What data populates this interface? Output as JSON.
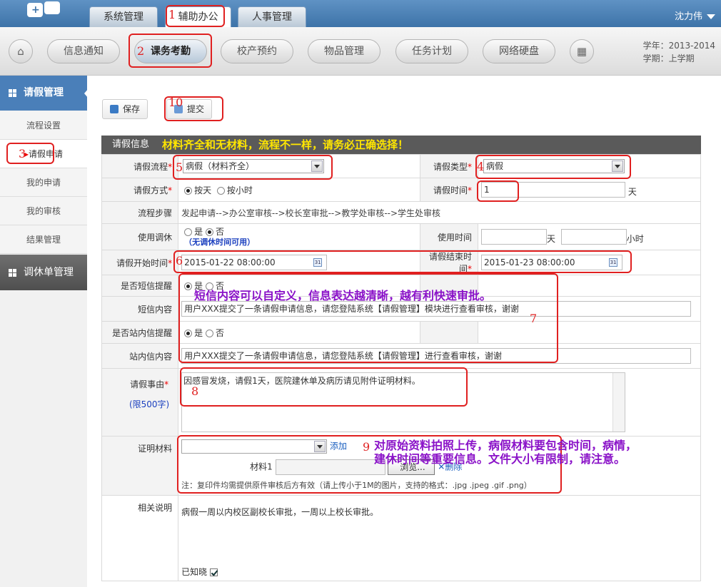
{
  "top_tabs": [
    {
      "label": "系统管理"
    },
    {
      "label": "辅助办公"
    },
    {
      "label": "人事管理"
    }
  ],
  "user": {
    "name": "沈力伟"
  },
  "nav": [
    {
      "label": "信息通知"
    },
    {
      "label": "课务考勤"
    },
    {
      "label": "校产预约"
    },
    {
      "label": "物品管理"
    },
    {
      "label": "任务计划"
    },
    {
      "label": "网络硬盘"
    }
  ],
  "school": {
    "year": "学年：2013-2014",
    "term": "学期：上学期"
  },
  "sidebar": {
    "leave": {
      "title": "请假管理",
      "items": [
        {
          "label": "流程设置"
        },
        {
          "label": "请假申请"
        },
        {
          "label": "我的申请"
        },
        {
          "label": "我的审核"
        },
        {
          "label": "结果管理"
        }
      ]
    },
    "rest": {
      "title": "调休单管理"
    }
  },
  "toolbar": {
    "save": "保存",
    "submit": "提交"
  },
  "form": {
    "header": "请假信息",
    "header_note": "材料齐全和无材料，流程不一样，请务必正确选择！",
    "process_label": "请假流程",
    "process_value": "病假（材料齐全）",
    "type_label": "请假类型",
    "type_value": "病假",
    "method_label": "请假方式",
    "method_opt1": "按天",
    "method_opt2": "按小时",
    "time_label": "请假时间",
    "time_value": "1",
    "time_unit": "天",
    "steps_label": "流程步骤",
    "steps_value": "发起申请-->办公室审核-->校长室审批-->教学处审核-->学生处审核",
    "use_rest_label": "使用调休",
    "yes": "是",
    "no": "否",
    "use_rest_note": "（无调休时间可用）",
    "use_time_label": "使用时间",
    "day_unit": "天",
    "hour_unit": "小时",
    "start_label": "请假开始时间",
    "start_value": "2015-01-22 08:00:00",
    "end_label": "请假结束时间",
    "end_value": "2015-01-23 08:00:00",
    "sms_label": "是否短信提醒",
    "sms_content_label": "短信内容",
    "sms_content": "用户XXX提交了一条请假申请信息，请您登陆系统【请假管理】模块进行查看审核，谢谢",
    "site_label": "是否站内信提醒",
    "site_content_label": "站内信内容",
    "site_content": "用户XXX提交了一条请假申请信息，请您登陆系统【请假管理】进行查看审核，谢谢",
    "reason_label": "请假事由",
    "reason_limit": "(限500字)",
    "reason_value": "因感冒发烧，请假1天，医院建休单及病历请见附件证明材料。",
    "proof_label": "证明材料",
    "add": "添加",
    "material_label": "材料1",
    "browse": "浏览...",
    "delete": "删除",
    "proof_note": "注：复印件均需提供原件审核后方有效（请上传小于1M的图片，支持的格式：.jpg .jpeg .gif .png）",
    "desc_label": "相关说明",
    "desc_value": "病假一周以内校区副校长审批，一周以上校长审批。",
    "known_label": "已知晓"
  },
  "annotations": {
    "n1": "1",
    "n2": "2",
    "n3": "3",
    "n4": "4",
    "n5": "5",
    "n6": "6",
    "n7": "7",
    "n8": "8",
    "n9": "9",
    "n10": "10",
    "sms_note": "短信内容可以自定义，信息表达越清晰，越有利快速审批。",
    "upload_note_1": "对原始资料拍照上传，病假材料要包含时间，病情，",
    "upload_note_2": "建休时间等重要信息。文件大小有限制，请注意。"
  },
  "colors": {
    "top": "#3d73a8",
    "side_active": "#4a7fb9",
    "annotation": "#e02020",
    "note_yellow": "#ffe600",
    "note_purple": "#8a12c8"
  }
}
